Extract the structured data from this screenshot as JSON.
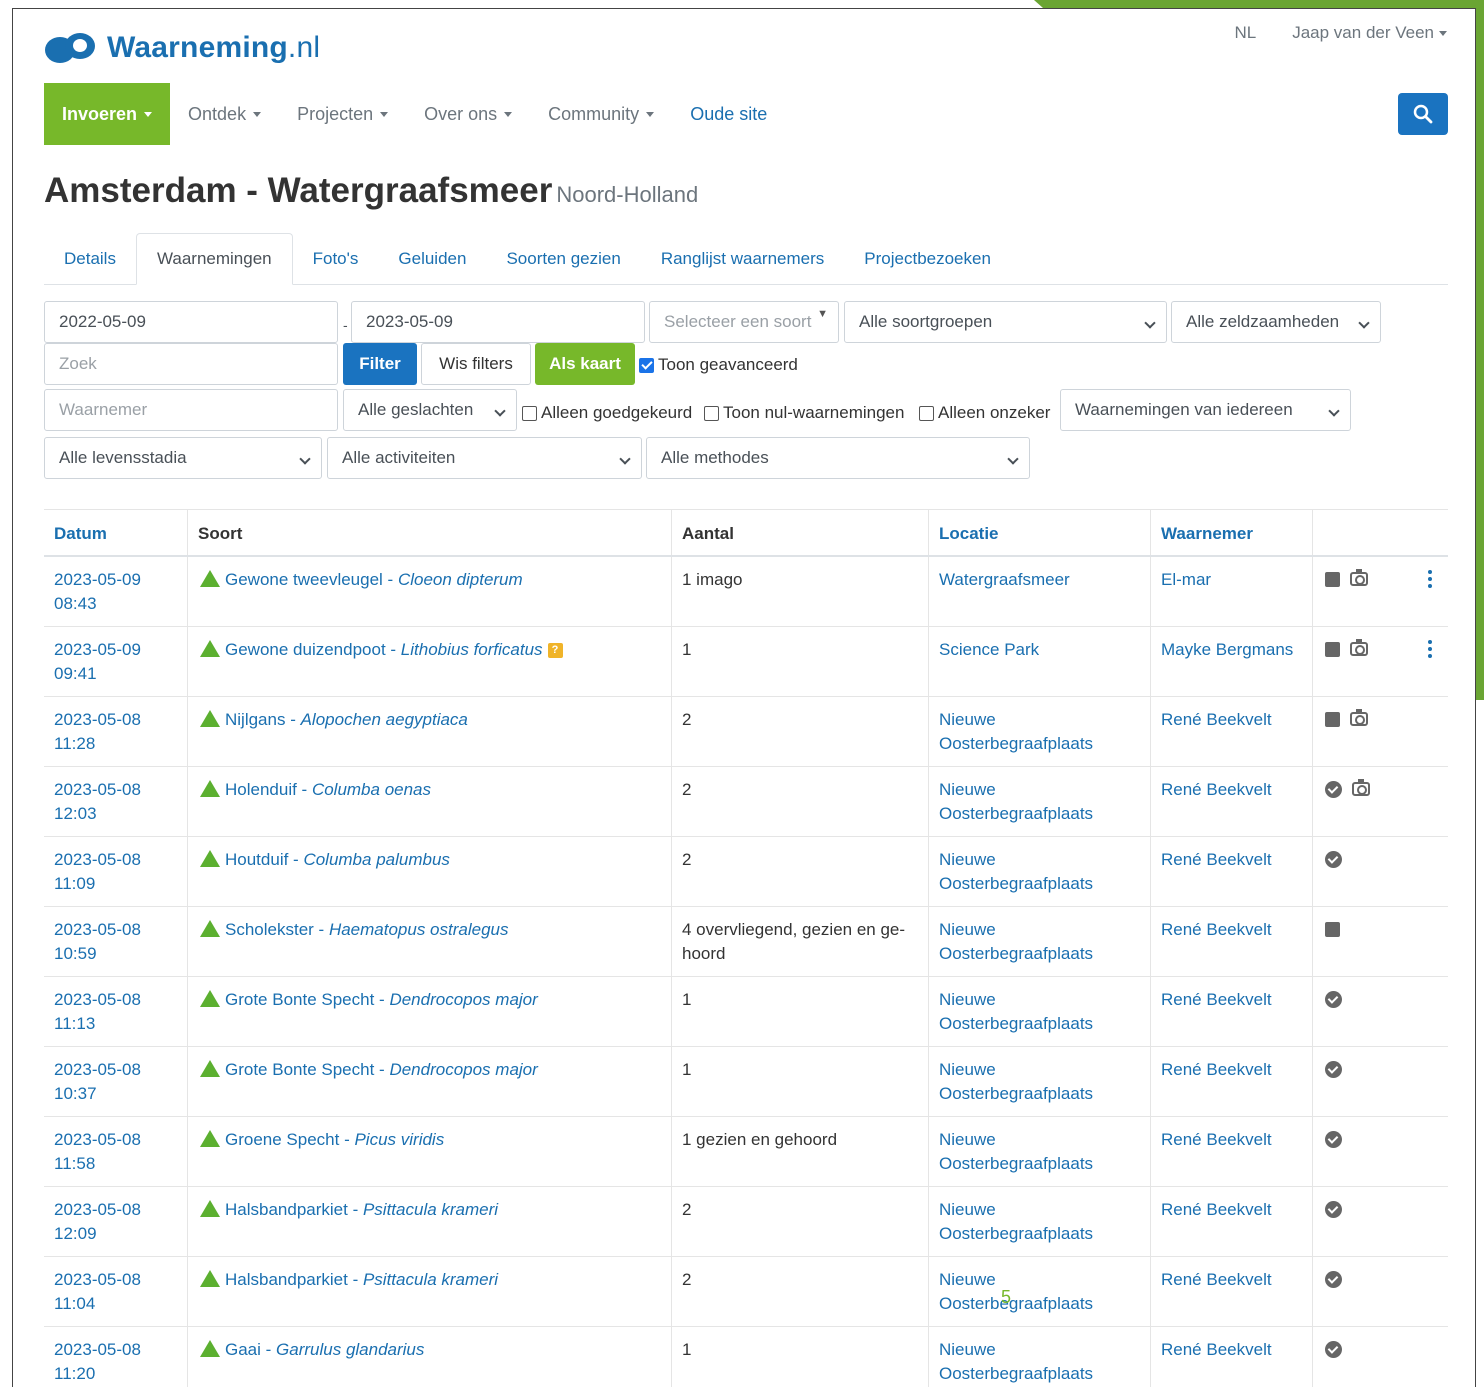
{
  "header": {
    "logo_main": "Waarneming",
    "logo_tld": ".nl",
    "language": "NL",
    "user": "Jaap van der Veen"
  },
  "nav": {
    "items": [
      {
        "label": "Invoeren"
      },
      {
        "label": "Ontdek"
      },
      {
        "label": "Projecten"
      },
      {
        "label": "Over ons"
      },
      {
        "label": "Community"
      },
      {
        "label": "Oude site"
      }
    ]
  },
  "page": {
    "title": "Amsterdam - Watergraafsmeer",
    "subtitle": "Noord-Holland"
  },
  "tabs": [
    {
      "label": "Details"
    },
    {
      "label": "Waarnemingen"
    },
    {
      "label": "Foto's"
    },
    {
      "label": "Geluiden"
    },
    {
      "label": "Soorten gezien"
    },
    {
      "label": "Ranglijst waarnemers"
    },
    {
      "label": "Projectbezoeken"
    }
  ],
  "filters": {
    "date_from": "2022-05-09",
    "date_to": "2023-05-09",
    "species_placeholder": "Selecteer een soort",
    "species_groups": "Alle soortgroepen",
    "rarity": "Alle zeldzaamheden",
    "search_placeholder": "Zoek",
    "filter_button": "Filter",
    "clear_button": "Wis filters",
    "map_button": "Als kaart",
    "advanced_label": "Toon geavanceerd",
    "observer_placeholder": "Waarnemer",
    "sexes": "Alle geslachten",
    "approved_only": "Alleen goedgekeurd",
    "show_null": "Toon nul-waarnemingen",
    "uncertain_only": "Alleen onzeker",
    "observations_of": "Waarnemingen van iedereen",
    "life_stages": "Alle levensstadia",
    "activities": "Alle activiteiten",
    "methods": "Alle methodes"
  },
  "table": {
    "headers": {
      "date": "Datum",
      "species": "Soort",
      "count": "Aantal",
      "location": "Locatie",
      "observer": "Waarnemer"
    },
    "rows": [
      {
        "date": "2023-05-09",
        "time": "08:43",
        "name": "Gewone tweevleugel",
        "sci": "Cloeon dipterum",
        "count": "1 imago",
        "loc1": "Watergraafsmeer",
        "loc2": "",
        "observer": "El-mar",
        "icons": "sq-cam-dots",
        "q": ""
      },
      {
        "date": "2023-05-09",
        "time": "09:41",
        "name": "Gewone duizendpoot",
        "sci": "Lithobius forficatus",
        "count": "1",
        "loc1": "Science Park",
        "loc2": "",
        "observer": "Mayke Bergmans",
        "icons": "sq-cam-dots",
        "q": "?"
      },
      {
        "date": "2023-05-08",
        "time": "11:28",
        "name": "Nijlgans",
        "sci": "Alopochen aegyptiaca",
        "count": "2",
        "loc1": "Nieuwe",
        "loc2": "Oosterbegraafplaats",
        "observer": "René Beekvelt",
        "icons": "sq-cam",
        "q": ""
      },
      {
        "date": "2023-05-08",
        "time": "12:03",
        "name": "Holenduif",
        "sci": "Columba oenas",
        "count": "2",
        "loc1": "Nieuwe",
        "loc2": "Oosterbegraafplaats",
        "observer": "René Beekvelt",
        "icons": "badge-cam",
        "q": ""
      },
      {
        "date": "2023-05-08",
        "time": "11:09",
        "name": "Houtduif",
        "sci": "Columba palumbus",
        "count": "2",
        "loc1": "Nieuwe",
        "loc2": "Oosterbegraafplaats",
        "observer": "René Beekvelt",
        "icons": "badge",
        "q": ""
      },
      {
        "date": "2023-05-08",
        "time": "10:59",
        "name": "Scholekster",
        "sci": "Haematopus ostralegus",
        "count": "4 overvliegend, gezien en ge-hoord",
        "loc1": "Nieuwe",
        "loc2": "Oosterbegraafplaats",
        "observer": "René Beekvelt",
        "icons": "sq",
        "q": ""
      },
      {
        "date": "2023-05-08",
        "time": "11:13",
        "name": "Grote Bonte Specht",
        "sci": "Dendrocopos major",
        "count": "1",
        "loc1": "Nieuwe",
        "loc2": "Oosterbegraafplaats",
        "observer": "René Beekvelt",
        "icons": "badge",
        "q": ""
      },
      {
        "date": "2023-05-08",
        "time": "10:37",
        "name": "Grote Bonte Specht",
        "sci": "Dendrocopos major",
        "count": "1",
        "loc1": "Nieuwe",
        "loc2": "Oosterbegraafplaats",
        "observer": "René Beekvelt",
        "icons": "badge",
        "q": ""
      },
      {
        "date": "2023-05-08",
        "time": "11:58",
        "name": "Groene Specht",
        "sci": "Picus viridis",
        "count": "1 gezien en gehoord",
        "loc1": "Nieuwe",
        "loc2": "Oosterbegraafplaats",
        "observer": "René Beekvelt",
        "icons": "badge",
        "q": ""
      },
      {
        "date": "2023-05-08",
        "time": "12:09",
        "name": "Halsbandparkiet",
        "sci": "Psittacula krameri",
        "count": "2",
        "loc1": "Nieuwe",
        "loc2": "Oosterbegraafplaats",
        "observer": "René Beekvelt",
        "icons": "badge",
        "q": ""
      },
      {
        "date": "2023-05-08",
        "time": "11:04",
        "name": "Halsbandparkiet",
        "sci": "Psittacula krameri",
        "count": "2",
        "loc1": "Nieuwe",
        "loc2": "Oosterbegraafplaats",
        "observer": "René Beekvelt",
        "icons": "badge",
        "q": ""
      },
      {
        "date": "2023-05-08",
        "time": "11:20",
        "name": "Gaai",
        "sci": "Garrulus glandarius",
        "count": "1",
        "loc1": "Nieuwe",
        "loc2": "Oosterbegraafplaats",
        "observer": "René Beekvelt",
        "icons": "badge",
        "q": ""
      }
    ]
  },
  "overlay": {
    "stray_mark": "5"
  },
  "colors": {
    "brand_blue": "#1a6fb0",
    "brand_green": "#77b82a",
    "button_blue": "#1a73c0"
  }
}
